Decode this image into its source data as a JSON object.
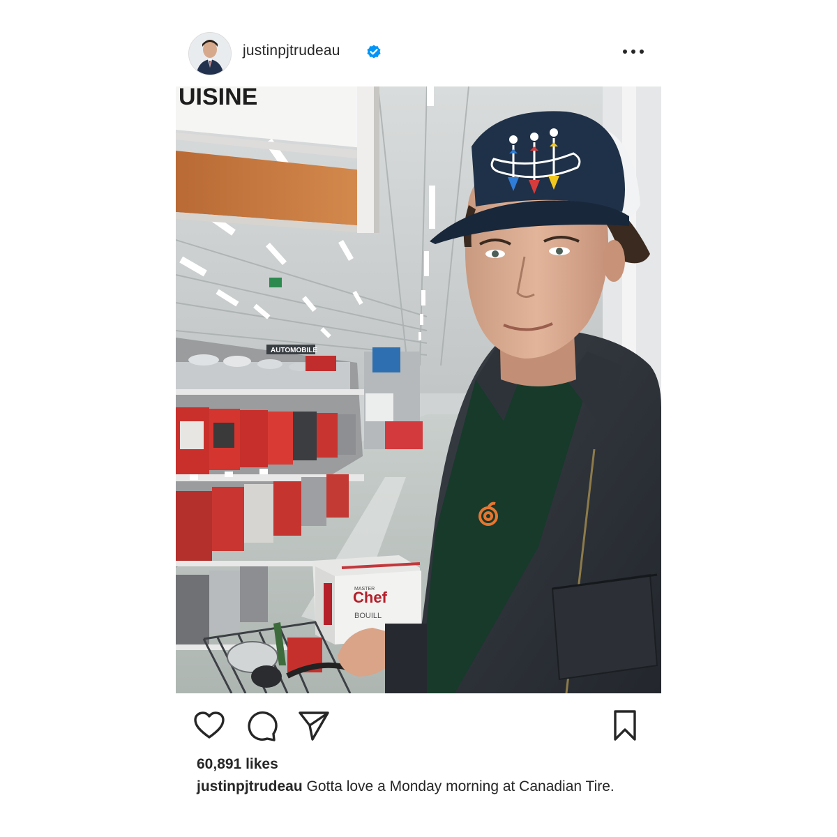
{
  "post": {
    "username": "justinpjtrudeau",
    "verified": true,
    "more_icon": "more-horizontal-icon",
    "photo": {
      "sign_text": "UISINE",
      "aisle_sign_text": "AUTOMOBILE",
      "box_brand": "Chef",
      "box_brand_small": "MASTER",
      "box_sub": "BOUILL"
    },
    "actions": {
      "like_icon": "heart-icon",
      "comment_icon": "comment-icon",
      "share_icon": "send-icon",
      "save_icon": "bookmark-icon"
    },
    "likes": "60,891 likes",
    "caption": {
      "username": "justinpjtrudeau",
      "text": "Gotta love a Monday morning at Canadian Tire."
    }
  },
  "colors": {
    "text": "#262626",
    "verified_blue": "#0095f6",
    "cap_navy": "#1f3148"
  }
}
